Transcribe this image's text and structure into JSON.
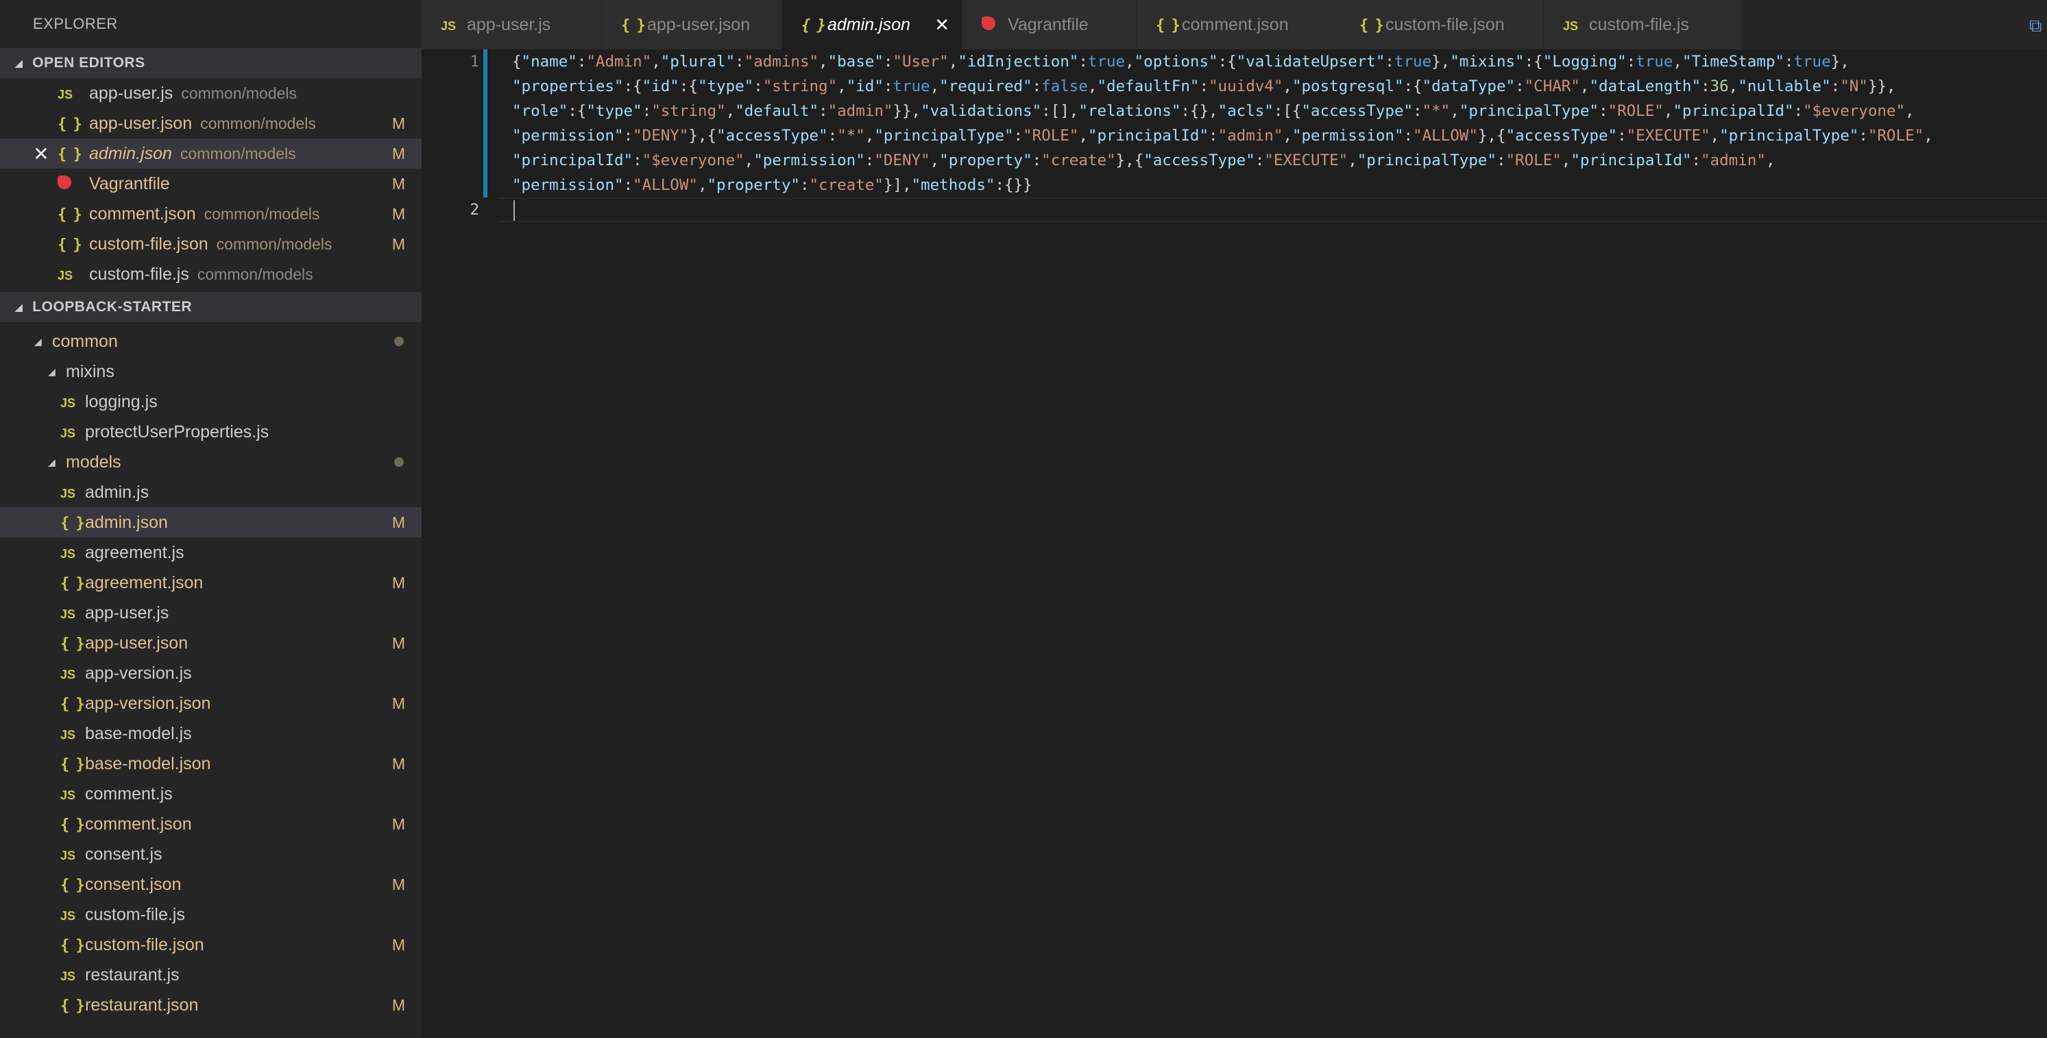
{
  "sidebar": {
    "title": "EXPLORER",
    "open_editors": {
      "header": "OPEN EDITORS",
      "items": [
        {
          "icon": "js",
          "name": "app-user.js",
          "path": "common/models",
          "badge": "",
          "state": "normal"
        },
        {
          "icon": "json",
          "name": "app-user.json",
          "path": "common/models",
          "badge": "M",
          "state": "modified"
        },
        {
          "icon": "json",
          "name": "admin.json",
          "path": "common/models",
          "badge": "M",
          "state": "active"
        },
        {
          "icon": "vagrant",
          "name": "Vagrantfile",
          "path": "",
          "badge": "M",
          "state": "modified"
        },
        {
          "icon": "json",
          "name": "comment.json",
          "path": "common/models",
          "badge": "M",
          "state": "modified"
        },
        {
          "icon": "json",
          "name": "custom-file.json",
          "path": "common/models",
          "badge": "M",
          "state": "modified"
        },
        {
          "icon": "js",
          "name": "custom-file.js",
          "path": "common/models",
          "badge": "",
          "state": "normal"
        }
      ]
    },
    "project": {
      "header": "LOOPBACK-STARTER",
      "tree": [
        {
          "depth": 1,
          "type": "folder",
          "open": true,
          "name": "common",
          "state": "modified-dot"
        },
        {
          "depth": 2,
          "type": "folder",
          "open": true,
          "name": "mixins",
          "state": "normal"
        },
        {
          "depth": 3,
          "type": "js",
          "name": "logging.js",
          "state": "normal"
        },
        {
          "depth": 3,
          "type": "js",
          "name": "protectUserProperties.js",
          "state": "normal"
        },
        {
          "depth": 2,
          "type": "folder",
          "open": true,
          "name": "models",
          "state": "modified-dot"
        },
        {
          "depth": 3,
          "type": "js",
          "name": "admin.js",
          "state": "normal"
        },
        {
          "depth": 3,
          "type": "json",
          "name": "admin.json",
          "state": "modified",
          "active": true,
          "badge": "M"
        },
        {
          "depth": 3,
          "type": "js",
          "name": "agreement.js",
          "state": "normal"
        },
        {
          "depth": 3,
          "type": "json",
          "name": "agreement.json",
          "state": "modified",
          "badge": "M"
        },
        {
          "depth": 3,
          "type": "js",
          "name": "app-user.js",
          "state": "normal"
        },
        {
          "depth": 3,
          "type": "json",
          "name": "app-user.json",
          "state": "modified",
          "badge": "M"
        },
        {
          "depth": 3,
          "type": "js",
          "name": "app-version.js",
          "state": "normal"
        },
        {
          "depth": 3,
          "type": "json",
          "name": "app-version.json",
          "state": "modified",
          "badge": "M"
        },
        {
          "depth": 3,
          "type": "js",
          "name": "base-model.js",
          "state": "normal"
        },
        {
          "depth": 3,
          "type": "json",
          "name": "base-model.json",
          "state": "modified",
          "badge": "M"
        },
        {
          "depth": 3,
          "type": "js",
          "name": "comment.js",
          "state": "normal"
        },
        {
          "depth": 3,
          "type": "json",
          "name": "comment.json",
          "state": "modified",
          "badge": "M"
        },
        {
          "depth": 3,
          "type": "js",
          "name": "consent.js",
          "state": "normal"
        },
        {
          "depth": 3,
          "type": "json",
          "name": "consent.json",
          "state": "modified",
          "badge": "M"
        },
        {
          "depth": 3,
          "type": "js",
          "name": "custom-file.js",
          "state": "normal"
        },
        {
          "depth": 3,
          "type": "json",
          "name": "custom-file.json",
          "state": "modified",
          "badge": "M"
        },
        {
          "depth": 3,
          "type": "js",
          "name": "restaurant.js",
          "state": "normal"
        },
        {
          "depth": 3,
          "type": "json",
          "name": "restaurant.json",
          "state": "modified",
          "badge": "M"
        }
      ]
    }
  },
  "tabs": [
    {
      "icon": "js",
      "label": "app-user.js",
      "active": false
    },
    {
      "icon": "json",
      "label": "app-user.json",
      "active": false
    },
    {
      "icon": "json",
      "label": "admin.json",
      "active": true
    },
    {
      "icon": "vagrant",
      "label": "Vagrantfile",
      "active": false
    },
    {
      "icon": "json",
      "label": "comment.json",
      "active": false
    },
    {
      "icon": "json",
      "label": "custom-file.json",
      "active": false
    },
    {
      "icon": "js",
      "label": "custom-file.js",
      "active": false
    }
  ],
  "editor": {
    "line_numbers": [
      "1",
      "2"
    ],
    "lines": [
      [
        [
          "p",
          "{"
        ],
        [
          "k",
          "\"name\""
        ],
        [
          "p",
          ":"
        ],
        [
          "s",
          "\"Admin\""
        ],
        [
          "p",
          ","
        ],
        [
          "k",
          "\"plural\""
        ],
        [
          "p",
          ":"
        ],
        [
          "s",
          "\"admins\""
        ],
        [
          "p",
          ","
        ],
        [
          "k",
          "\"base\""
        ],
        [
          "p",
          ":"
        ],
        [
          "s",
          "\"User\""
        ],
        [
          "p",
          ","
        ],
        [
          "k",
          "\"idInjection\""
        ],
        [
          "p",
          ":"
        ],
        [
          "b",
          "true"
        ],
        [
          "p",
          ","
        ],
        [
          "k",
          "\"options\""
        ],
        [
          "p",
          ":{"
        ],
        [
          "k",
          "\"validateUpsert\""
        ],
        [
          "p",
          ":"
        ],
        [
          "b",
          "true"
        ],
        [
          "p",
          "},"
        ],
        [
          "k",
          "\"mixins\""
        ],
        [
          "p",
          ":{"
        ],
        [
          "k",
          "\"Logging\""
        ],
        [
          "p",
          ":"
        ],
        [
          "b",
          "true"
        ],
        [
          "p",
          ","
        ],
        [
          "k",
          "\"TimeStamp\""
        ],
        [
          "p",
          ":"
        ],
        [
          "b",
          "true"
        ],
        [
          "p",
          "},"
        ]
      ],
      [
        [
          "k",
          "\"properties\""
        ],
        [
          "p",
          ":{"
        ],
        [
          "k",
          "\"id\""
        ],
        [
          "p",
          ":{"
        ],
        [
          "k",
          "\"type\""
        ],
        [
          "p",
          ":"
        ],
        [
          "s",
          "\"string\""
        ],
        [
          "p",
          ","
        ],
        [
          "k",
          "\"id\""
        ],
        [
          "p",
          ":"
        ],
        [
          "b",
          "true"
        ],
        [
          "p",
          ","
        ],
        [
          "k",
          "\"required\""
        ],
        [
          "p",
          ":"
        ],
        [
          "b",
          "false"
        ],
        [
          "p",
          ","
        ],
        [
          "k",
          "\"defaultFn\""
        ],
        [
          "p",
          ":"
        ],
        [
          "s",
          "\"uuidv4\""
        ],
        [
          "p",
          ","
        ],
        [
          "k",
          "\"postgresql\""
        ],
        [
          "p",
          ":{"
        ],
        [
          "k",
          "\"dataType\""
        ],
        [
          "p",
          ":"
        ],
        [
          "s",
          "\"CHAR\""
        ],
        [
          "p",
          ","
        ],
        [
          "k",
          "\"dataLength\""
        ],
        [
          "p",
          ":"
        ],
        [
          "n",
          "36"
        ],
        [
          "p",
          ","
        ],
        [
          "k",
          "\"nullable\""
        ],
        [
          "p",
          ":"
        ],
        [
          "s",
          "\"N\""
        ],
        [
          "p",
          "}},"
        ]
      ],
      [
        [
          "k",
          "\"role\""
        ],
        [
          "p",
          ":{"
        ],
        [
          "k",
          "\"type\""
        ],
        [
          "p",
          ":"
        ],
        [
          "s",
          "\"string\""
        ],
        [
          "p",
          ","
        ],
        [
          "k",
          "\"default\""
        ],
        [
          "p",
          ":"
        ],
        [
          "s",
          "\"admin\""
        ],
        [
          "p",
          "}},"
        ],
        [
          "k",
          "\"validations\""
        ],
        [
          "p",
          ":[],"
        ],
        [
          "k",
          "\"relations\""
        ],
        [
          "p",
          ":{},"
        ],
        [
          "k",
          "\"acls\""
        ],
        [
          "p",
          ":[{"
        ],
        [
          "k",
          "\"accessType\""
        ],
        [
          "p",
          ":"
        ],
        [
          "s",
          "\"*\""
        ],
        [
          "p",
          ","
        ],
        [
          "k",
          "\"principalType\""
        ],
        [
          "p",
          ":"
        ],
        [
          "s",
          "\"ROLE\""
        ],
        [
          "p",
          ","
        ],
        [
          "k",
          "\"principalId\""
        ],
        [
          "p",
          ":"
        ],
        [
          "s",
          "\"$everyone\""
        ],
        [
          "p",
          ","
        ]
      ],
      [
        [
          "k",
          "\"permission\""
        ],
        [
          "p",
          ":"
        ],
        [
          "s",
          "\"DENY\""
        ],
        [
          "p",
          "},{"
        ],
        [
          "k",
          "\"accessType\""
        ],
        [
          "p",
          ":"
        ],
        [
          "s",
          "\"*\""
        ],
        [
          "p",
          ","
        ],
        [
          "k",
          "\"principalType\""
        ],
        [
          "p",
          ":"
        ],
        [
          "s",
          "\"ROLE\""
        ],
        [
          "p",
          ","
        ],
        [
          "k",
          "\"principalId\""
        ],
        [
          "p",
          ":"
        ],
        [
          "s",
          "\"admin\""
        ],
        [
          "p",
          ","
        ],
        [
          "k",
          "\"permission\""
        ],
        [
          "p",
          ":"
        ],
        [
          "s",
          "\"ALLOW\""
        ],
        [
          "p",
          "},{"
        ],
        [
          "k",
          "\"accessType\""
        ],
        [
          "p",
          ":"
        ],
        [
          "s",
          "\"EXECUTE\""
        ],
        [
          "p",
          ","
        ],
        [
          "k",
          "\"principalType\""
        ],
        [
          "p",
          ":"
        ],
        [
          "s",
          "\"ROLE\""
        ],
        [
          "p",
          ","
        ]
      ],
      [
        [
          "k",
          "\"principalId\""
        ],
        [
          "p",
          ":"
        ],
        [
          "s",
          "\"$everyone\""
        ],
        [
          "p",
          ","
        ],
        [
          "k",
          "\"permission\""
        ],
        [
          "p",
          ":"
        ],
        [
          "s",
          "\"DENY\""
        ],
        [
          "p",
          ","
        ],
        [
          "k",
          "\"property\""
        ],
        [
          "p",
          ":"
        ],
        [
          "s",
          "\"create\""
        ],
        [
          "p",
          "},{"
        ],
        [
          "k",
          "\"accessType\""
        ],
        [
          "p",
          ":"
        ],
        [
          "s",
          "\"EXECUTE\""
        ],
        [
          "p",
          ","
        ],
        [
          "k",
          "\"principalType\""
        ],
        [
          "p",
          ":"
        ],
        [
          "s",
          "\"ROLE\""
        ],
        [
          "p",
          ","
        ],
        [
          "k",
          "\"principalId\""
        ],
        [
          "p",
          ":"
        ],
        [
          "s",
          "\"admin\""
        ],
        [
          "p",
          ","
        ]
      ],
      [
        [
          "k",
          "\"permission\""
        ],
        [
          "p",
          ":"
        ],
        [
          "s",
          "\"ALLOW\""
        ],
        [
          "p",
          ","
        ],
        [
          "k",
          "\"property\""
        ],
        [
          "p",
          ":"
        ],
        [
          "s",
          "\"create\""
        ],
        [
          "p",
          "}],"
        ],
        [
          "k",
          "\"methods\""
        ],
        [
          "p",
          ":{}}"
        ]
      ]
    ]
  },
  "colors": {
    "modified": "#e2c08d",
    "json_icon": "#cbcb41",
    "js_icon": "#cbcb41",
    "vagrant_icon": "#e0393e",
    "gutter_modified": "#1b81a8"
  }
}
